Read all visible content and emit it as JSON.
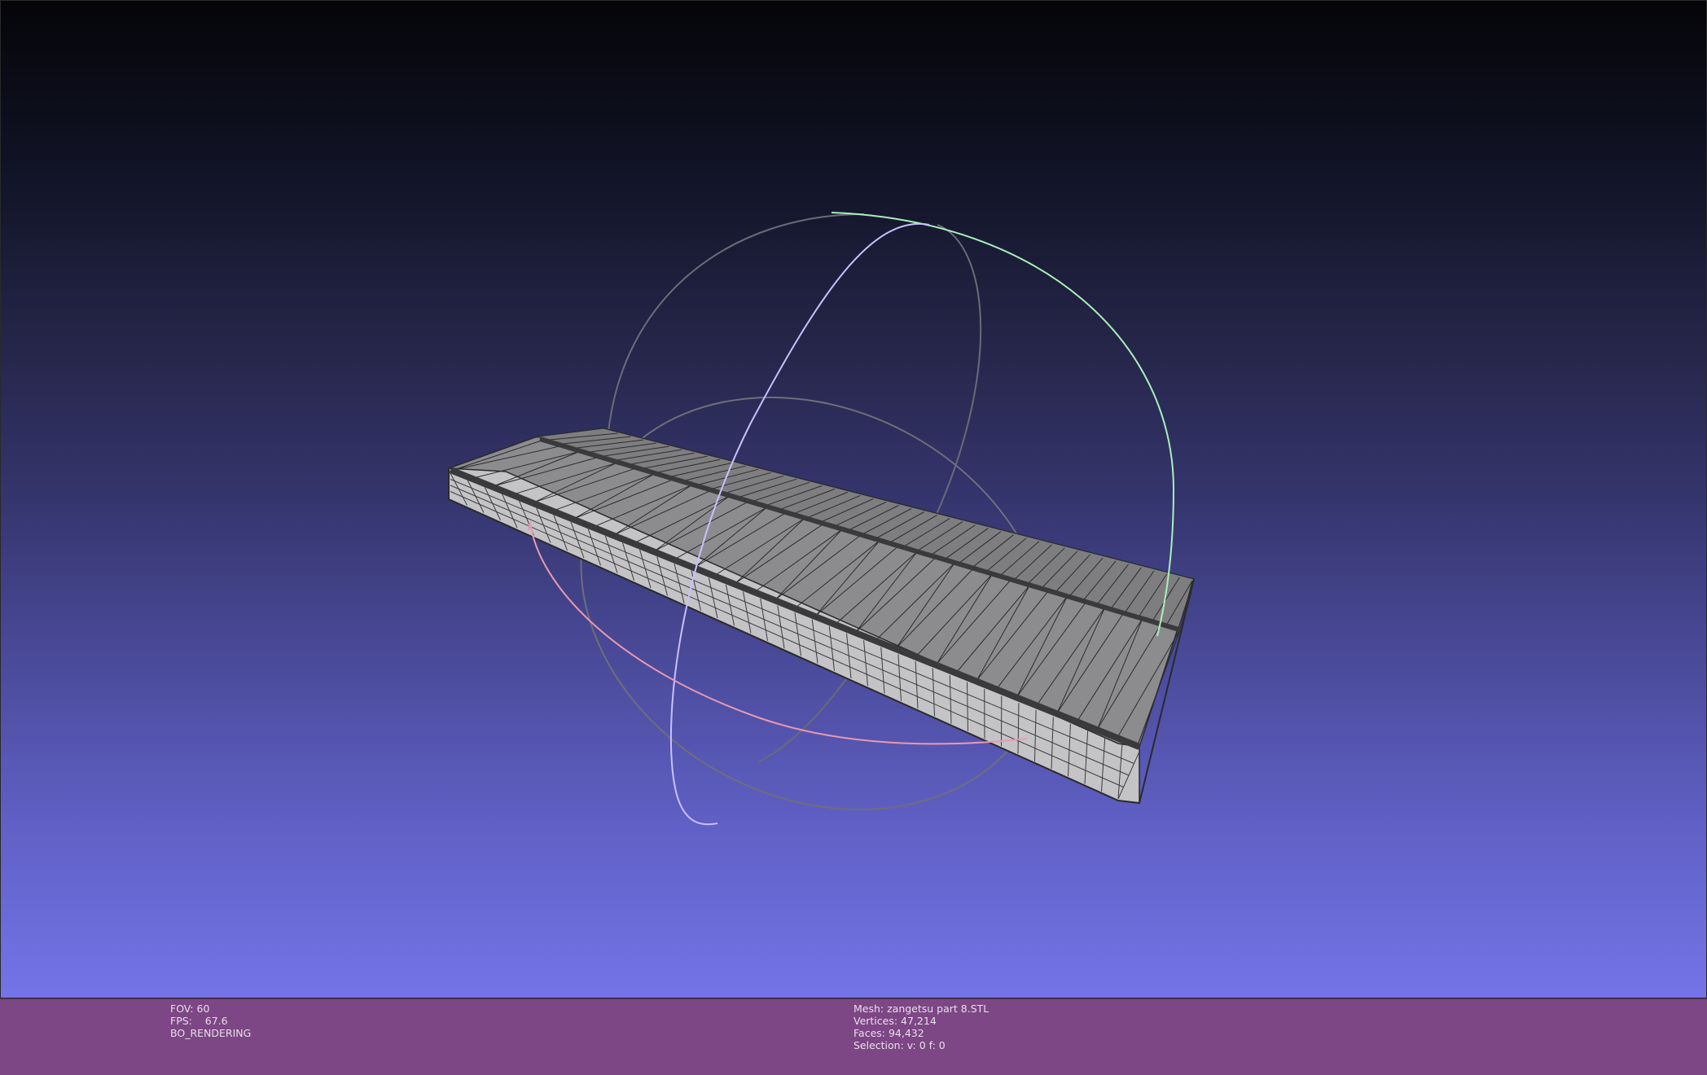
{
  "viewport": {
    "background_top": "#050508",
    "background_bottom": "#7474e8"
  },
  "mesh_colors": {
    "top_face": "#8a8a8a",
    "side_face": "#c8c8c8",
    "edge": "#222222",
    "groove": "#3a3a3a"
  },
  "trackball": {
    "x_ring_color": "#e89ab0",
    "y_ring_color": "#a8f0b8",
    "z_ring_color": "#c8c0ff",
    "ghost_color": "#707070"
  },
  "info_left": {
    "fov": "FOV: 60",
    "fps": "FPS:    67.6",
    "render_mode": "BO_RENDERING"
  },
  "info_right": {
    "mesh": "Mesh: zangetsu part 8.STL",
    "vertices": "Vertices: 47,214",
    "faces": "Faces: 94,432",
    "selection": "Selection: v: 0 f: 0"
  },
  "info_bar_color": "#7d4685"
}
